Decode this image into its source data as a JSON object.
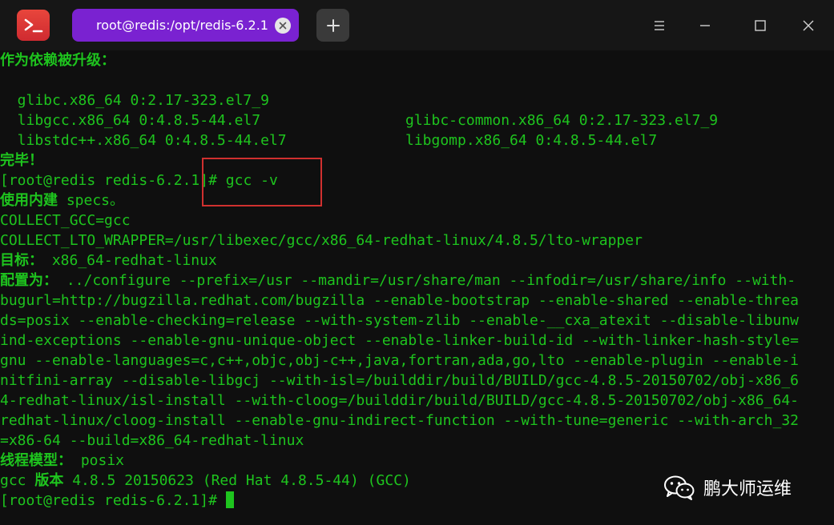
{
  "window": {
    "tab_title": "root@redis:/opt/redis-6.2.1",
    "icons": {
      "app": "terminal-prompt-icon",
      "tab_close": "close-icon",
      "new_tab": "plus-icon",
      "menu": "hamburger-menu-icon",
      "minimize": "minimize-icon",
      "maximize": "maximize-icon",
      "close": "close-icon"
    }
  },
  "colors": {
    "terminal_text": "#1ec41e",
    "tab_bg": "#7a22d1",
    "app_icon": "#e0393a",
    "highlight": "#d0302f"
  },
  "terminal": {
    "dep_header": "作为依赖被升级：",
    "deps_left": [
      "  glibc.x86_64 0:2.17-323.el7_9",
      "  libgcc.x86_64 0:4.8.5-44.el7",
      "  libstdc++.x86_64 0:4.8.5-44.el7"
    ],
    "deps_right": [
      "glibc-common.x86_64 0:2.17-323.el7_9",
      "libgomp.x86_64 0:4.8.5-44.el7"
    ],
    "done": "完毕！",
    "prompt": "[root@redis redis-6.2.1]# ",
    "command": "gcc -v",
    "specs_label": "使用内建",
    "specs_value": " specs。",
    "collect_gcc": "COLLECT_GCC=gcc",
    "collect_lto": "COLLECT_LTO_WRAPPER=/usr/libexec/gcc/x86_64-redhat-linux/4.8.5/lto-wrapper",
    "target_label": "目标：",
    "target_value": " x86_64-redhat-linux",
    "config_label": "配置为：",
    "config_lines": [
      " ../configure --prefix=/usr --mandir=/usr/share/man --infodir=/usr/share/info --with-",
      "bugurl=http://bugzilla.redhat.com/bugzilla --enable-bootstrap --enable-shared --enable-threa",
      "ds=posix --enable-checking=release --with-system-zlib --enable-__cxa_atexit --disable-libunw",
      "ind-exceptions --enable-gnu-unique-object --enable-linker-build-id --with-linker-hash-style=",
      "gnu --enable-languages=c,c++,objc,obj-c++,java,fortran,ada,go,lto --enable-plugin --enable-i",
      "nitfini-array --disable-libgcj --with-isl=/builddir/build/BUILD/gcc-4.8.5-20150702/obj-x86_6",
      "4-redhat-linux/isl-install --with-cloog=/builddir/build/BUILD/gcc-4.8.5-20150702/obj-x86_64-",
      "redhat-linux/cloog-install --enable-gnu-indirect-function --with-tune=generic --with-arch_32",
      "=x86-64 --build=x86_64-redhat-linux"
    ],
    "thread_label": "线程模型：",
    "thread_value": " posix",
    "gcc_prefix": "gcc ",
    "gcc_label": "版本",
    "gcc_value": " 4.8.5 20150623 (Red Hat 4.8.5-44) (GCC)",
    "final_prompt": "[root@redis redis-6.2.1]# "
  },
  "watermark": {
    "text": "鹏大师运维",
    "icon": "wechat-icon"
  }
}
